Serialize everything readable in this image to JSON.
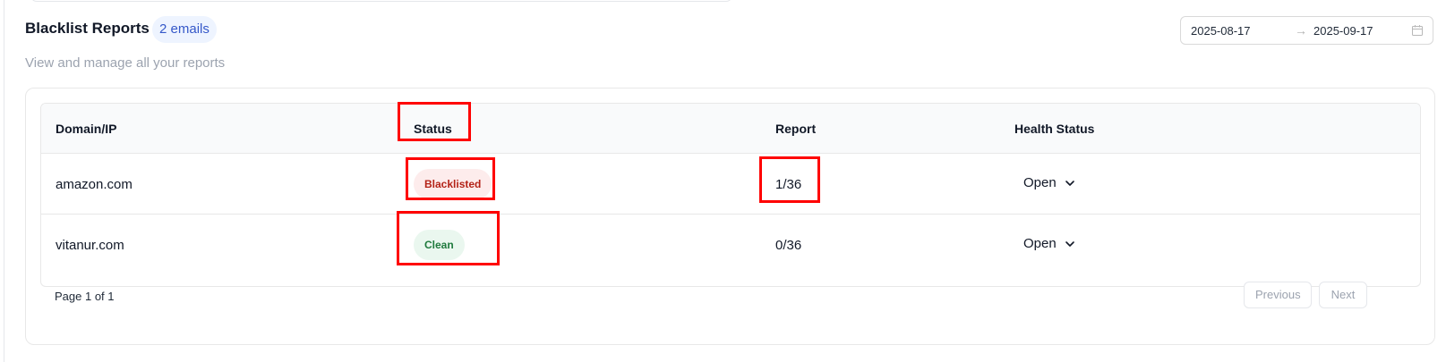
{
  "header": {
    "title": "Blacklist Reports",
    "email_count_badge": "2 emails",
    "subtitle": "View and manage all your reports"
  },
  "date_range": {
    "start": "2025-08-17",
    "separator": "→",
    "end": "2025-09-17",
    "icon": "calendar-icon"
  },
  "table": {
    "columns": [
      "Domain/IP",
      "Status",
      "Report",
      "Health Status"
    ],
    "rows": [
      {
        "domain": "amazon.com",
        "status": "Blacklisted",
        "report": "1/36",
        "health": "Open"
      },
      {
        "domain": "vitanur.com",
        "status": "Clean",
        "report": "0/36",
        "health": "Open"
      }
    ]
  },
  "pagination": {
    "info": "Page 1 of 1",
    "previous_label": "Previous",
    "next_label": "Next"
  },
  "colors": {
    "blacklisted_bg": "#fdecec",
    "blacklisted_text": "#b42318",
    "clean_bg": "#eaf7ef",
    "clean_text": "#1f7a3d",
    "badge_bg": "#eef4ff",
    "badge_text": "#3558c9",
    "highlight": "#ff0000"
  }
}
